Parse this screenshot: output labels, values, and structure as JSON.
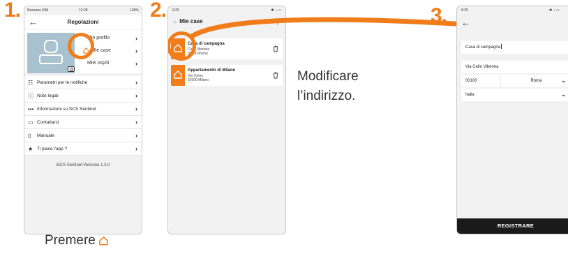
{
  "steps": [
    "1.",
    "2.",
    "3."
  ],
  "colors": {
    "accent": "#f07d1a",
    "card": "#ffffff",
    "screen_bg": "#f2f2f2",
    "button_dark": "#1a1a1a"
  },
  "screen1": {
    "status": {
      "carrier": "Nessuna SIM",
      "time": "12:28",
      "battery": "100%"
    },
    "title": "Regolazioni",
    "profile_items": [
      {
        "label": "Mio profilo",
        "icon": "user-icon"
      },
      {
        "label": "Mie case",
        "icon": "home-icon"
      },
      {
        "label": "Miei ospiti",
        "icon": "guests-icon"
      }
    ],
    "menu": [
      {
        "label": "Parametri per le notifiche",
        "icon": "sliders-icon"
      },
      {
        "label": "Note legali",
        "icon": "info-icon"
      },
      {
        "label": "Informazioni su SCS Sentinel",
        "icon": "more-icon"
      },
      {
        "label": "Contattarci",
        "icon": "chat-icon"
      },
      {
        "label": "Manuale",
        "icon": "document-icon"
      },
      {
        "label": "Ti piace l'app ?",
        "icon": "star-icon"
      }
    ],
    "version": "iSCS Sentinel Versione 1.3.0",
    "caption": "Premere"
  },
  "screen2": {
    "status": {
      "time": "9:25"
    },
    "title": "Mie case",
    "houses": [
      {
        "name": "Casa di campagna",
        "line1": "Celio Vibenna",
        "line2": "00100 Roma"
      },
      {
        "name": "Appartamento di Milano",
        "line1": "Via Torino",
        "line2": "20100 Milano"
      }
    ],
    "caption_line1": "Modificare",
    "caption_line2": "l’indirizzo."
  },
  "screen3": {
    "status": {
      "time": "9:25"
    },
    "name_value": "Casa di campagna",
    "street_value": "Via Celio Vibenna",
    "zip_value": "00100",
    "city_value": "Roma",
    "country_value": "Italia",
    "save_label": "REGISTRARE"
  }
}
